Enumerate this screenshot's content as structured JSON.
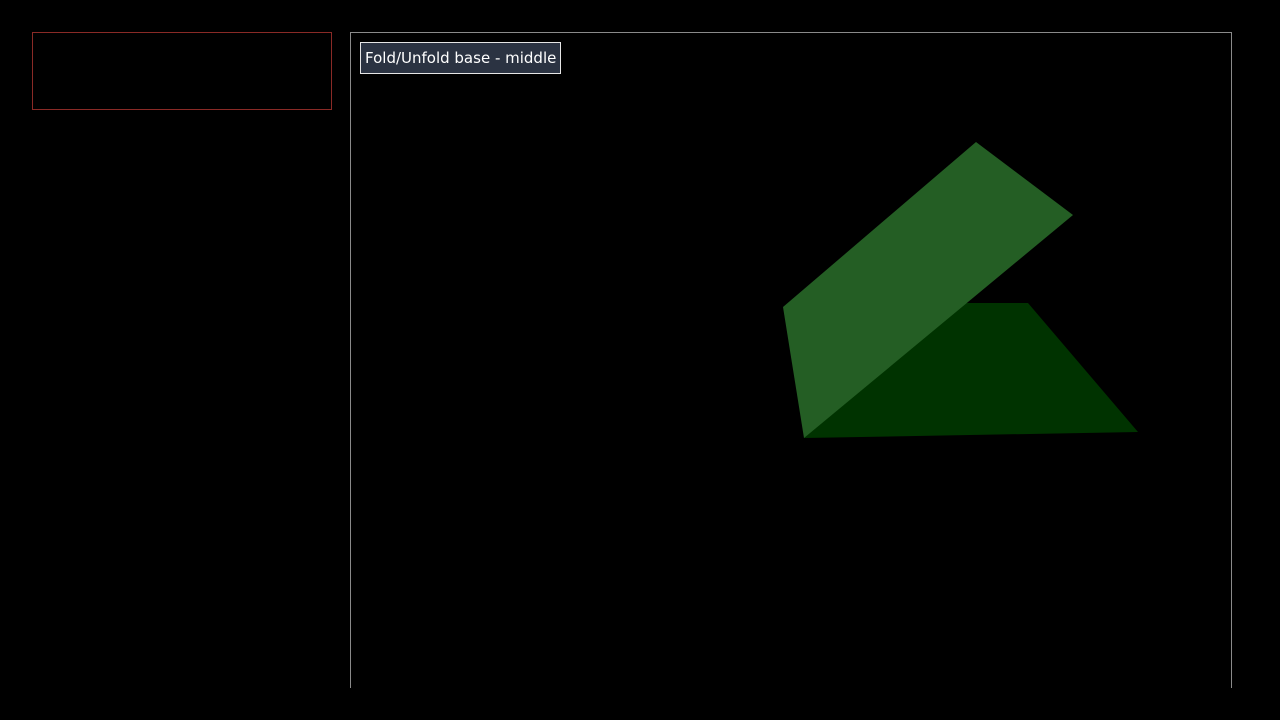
{
  "toolbar": {
    "fold_button_label": "Fold/Unfold base - middle"
  },
  "scene": {
    "object": "folded-paper",
    "colors": {
      "upper_flap": "#245e24",
      "base": "#003300",
      "panel_border": "#8a2a26",
      "viewport_border": "#8a8a8a"
    }
  }
}
